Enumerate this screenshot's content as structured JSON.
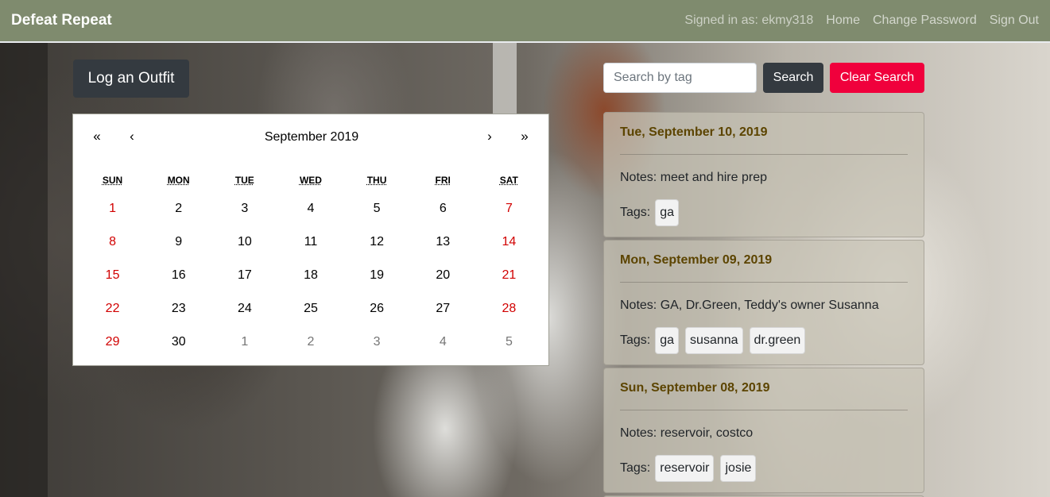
{
  "navbar": {
    "brand": "Defeat Repeat",
    "signed_in": "Signed in as: ekmy318",
    "links": [
      "Home",
      "Change Password",
      "Sign Out"
    ]
  },
  "log_button": "Log an Outfit",
  "calendar": {
    "prev_year": "«",
    "prev_month": "‹",
    "label": "September 2019",
    "next_month": "›",
    "next_year": "»",
    "weekdays": [
      "SUN",
      "MON",
      "TUE",
      "WED",
      "THU",
      "FRI",
      "SAT"
    ],
    "days": [
      "1",
      "2",
      "3",
      "4",
      "5",
      "6",
      "7",
      "8",
      "9",
      "10",
      "11",
      "12",
      "13",
      "14",
      "15",
      "16",
      "17",
      "18",
      "19",
      "20",
      "21",
      "22",
      "23",
      "24",
      "25",
      "26",
      "27",
      "28",
      "29",
      "30",
      "1",
      "2",
      "3",
      "4",
      "5"
    ]
  },
  "search": {
    "placeholder": "Search by tag",
    "button": "Search",
    "clear": "Clear Search"
  },
  "outfits": [
    {
      "date": "Tue, September 10, 2019",
      "notes": "Notes: meet and hire prep",
      "tags_label": "Tags:",
      "tags": [
        "ga"
      ]
    },
    {
      "date": "Mon, September 09, 2019",
      "notes": "Notes: GA, Dr.Green, Teddy's owner Susanna",
      "tags_label": "Tags:",
      "tags": [
        "ga",
        "susanna",
        "dr.green"
      ]
    },
    {
      "date": "Sun, September 08, 2019",
      "notes": "Notes: reservoir, costco",
      "tags_label": "Tags:",
      "tags": [
        "reservoir",
        "josie"
      ]
    }
  ],
  "colors": {
    "navbar_bg": "#7f8b6e",
    "dark_button": "#343a40",
    "danger_button": "#f0003c",
    "weekend_text": "#d10000",
    "card_date_text": "#5c4400"
  }
}
